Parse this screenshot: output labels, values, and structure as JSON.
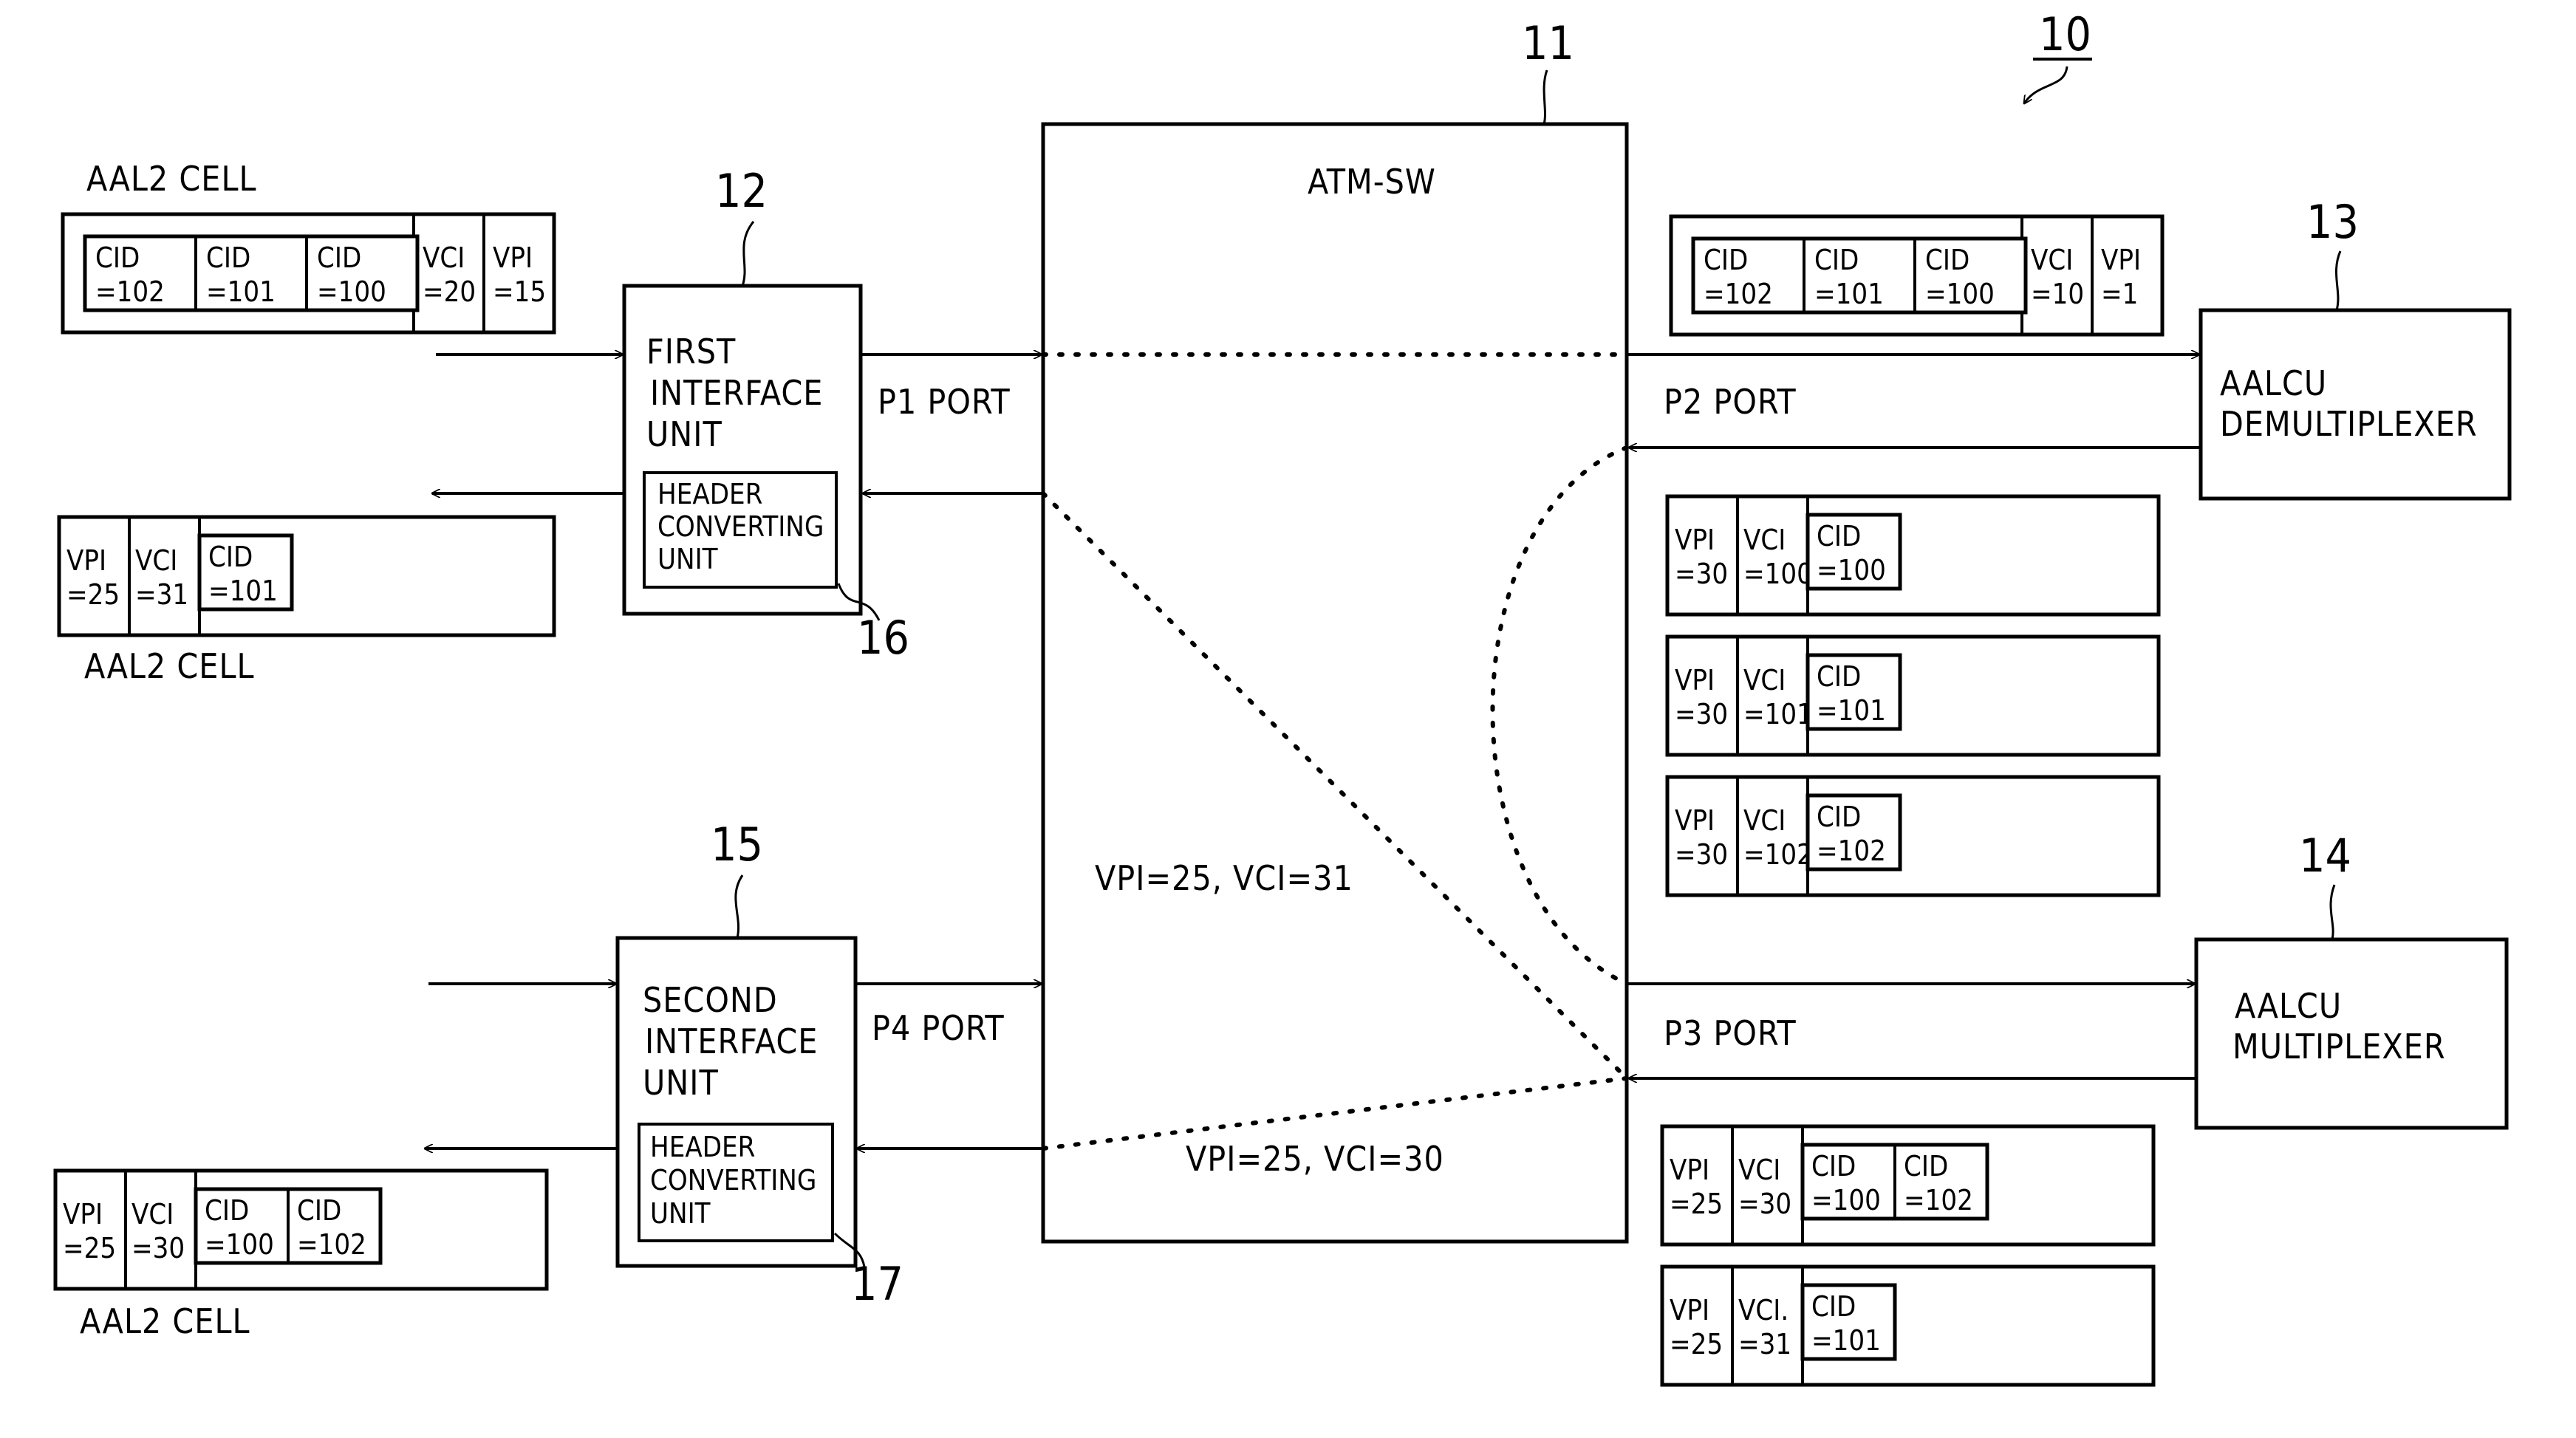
{
  "figure_ref": "10",
  "atm_switch": {
    "ref": "11",
    "label": "ATM-SW",
    "route_label_1": "VPI=25, VCI=31",
    "route_label_2": "VPI=25, VCI=30"
  },
  "first_interface": {
    "ref": "12",
    "lines": [
      "FIRST",
      "INTERFACE",
      "UNIT"
    ],
    "header_unit": {
      "ref": "16",
      "lines": [
        "HEADER",
        "CONVERTING",
        "UNIT"
      ]
    },
    "port": "P1 PORT"
  },
  "second_interface": {
    "ref": "15",
    "lines": [
      "SECOND",
      "INTERFACE",
      "UNIT"
    ],
    "header_unit": {
      "ref": "17",
      "lines": [
        "HEADER",
        "CONVERTING",
        "UNIT"
      ]
    },
    "port": "P4 PORT"
  },
  "demux": {
    "ref": "13",
    "lines": [
      "AALCU",
      "DEMULTIPLEXER"
    ],
    "port": "P2 PORT"
  },
  "mux": {
    "ref": "14",
    "lines": [
      "AALCU",
      "MULTIPLEXER"
    ],
    "port": "P3 PORT"
  },
  "cell_label": "AAL2 CELL",
  "cells": {
    "in_first": {
      "cids": [
        "CID =102",
        "CID =101",
        "CID =100"
      ],
      "vci": "VCI =20",
      "vpi": "VPI =15"
    },
    "out_first": {
      "vpi": "VPI =25",
      "vci": "VCI =31",
      "cids": [
        "CID =101"
      ]
    },
    "out_second": {
      "vpi": "VPI =25",
      "vci": "VCI =30",
      "cids": [
        "CID =100",
        "CID =102"
      ]
    },
    "to_demux": {
      "cids": [
        "CID =102",
        "CID =101",
        "CID =100"
      ],
      "vci": "VCI =10",
      "vpi": "VPI =1"
    },
    "demux_out": [
      {
        "vpi": "VPI =30",
        "vci": "VCI =100",
        "cids": [
          "CID =100"
        ]
      },
      {
        "vpi": "VPI =30",
        "vci": "VCI =101",
        "cids": [
          "CID =101"
        ]
      },
      {
        "vpi": "VPI =30",
        "vci": "VCI =102",
        "cids": [
          "CID =102"
        ]
      }
    ],
    "mux_out": [
      {
        "vpi": "VPI =25",
        "vci": "VCI =30",
        "cids": [
          "CID =100",
          "CID =102"
        ]
      },
      {
        "vpi": "VPI =25",
        "vci": "VCI. =31",
        "cids": [
          "CID =101"
        ]
      }
    ]
  }
}
